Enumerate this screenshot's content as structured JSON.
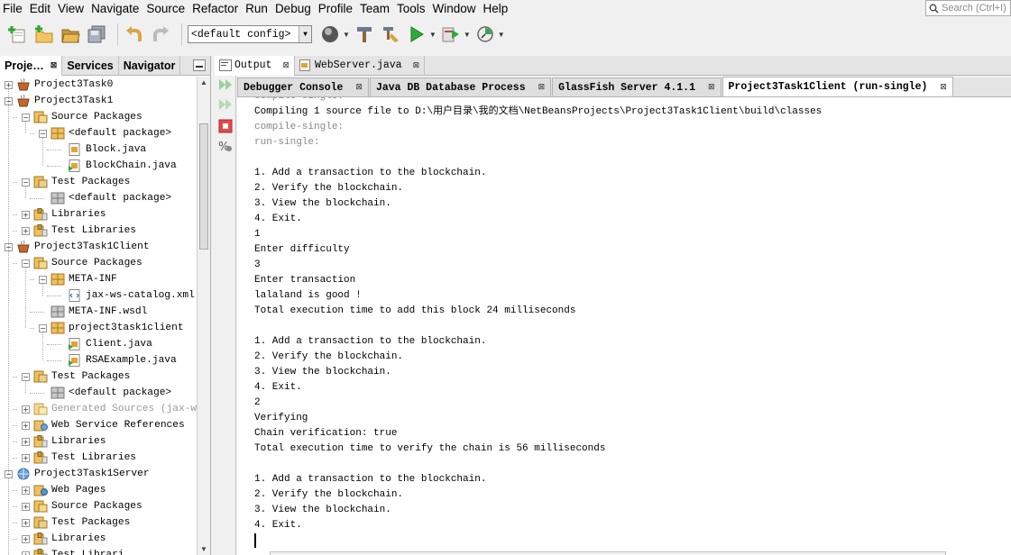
{
  "menu": [
    "File",
    "Edit",
    "View",
    "Navigate",
    "Source",
    "Refactor",
    "Run",
    "Debug",
    "Profile",
    "Team",
    "Tools",
    "Window",
    "Help"
  ],
  "search": {
    "placeholder": "Search (Ctrl+I)"
  },
  "toolbar": {
    "config_value": "<default config>",
    "icons": [
      "new-file-icon",
      "new-project-icon",
      "open-project-icon",
      "save-all-icon",
      "undo-icon",
      "redo-icon",
      "globe-icon",
      "build-icon",
      "clean-build-icon",
      "run-icon",
      "debug-icon",
      "profile-icon"
    ]
  },
  "left_panel": {
    "tabs": [
      {
        "label": "Proje…",
        "active": true
      },
      {
        "label": "Services",
        "active": false
      },
      {
        "label": "Navigator",
        "active": false
      }
    ],
    "tree": [
      {
        "label": "Project3Task0",
        "icon": "java-project-icon",
        "toggle": "+",
        "indent": 0
      },
      {
        "label": "Project3Task1",
        "icon": "java-project-icon",
        "toggle": "-",
        "indent": 0
      },
      {
        "label": "Source Packages",
        "icon": "source-packages-icon",
        "toggle": "-",
        "indent": 1
      },
      {
        "label": "<default package>",
        "icon": "package-icon",
        "toggle": "-",
        "indent": 2
      },
      {
        "label": "Block.java",
        "icon": "java-file-icon",
        "toggle": "",
        "indent": 3
      },
      {
        "label": "BlockChain.java",
        "icon": "java-main-file-icon",
        "toggle": "",
        "indent": 3
      },
      {
        "label": "Test Packages",
        "icon": "test-packages-icon",
        "toggle": "-",
        "indent": 1
      },
      {
        "label": "<default package>",
        "icon": "empty-package-icon",
        "toggle": "",
        "indent": 2
      },
      {
        "label": "Libraries",
        "icon": "libraries-icon",
        "toggle": "+",
        "indent": 1
      },
      {
        "label": "Test Libraries",
        "icon": "libraries-icon",
        "toggle": "+",
        "indent": 1
      },
      {
        "label": "Project3Task1Client",
        "icon": "java-project-icon",
        "toggle": "-",
        "indent": 0
      },
      {
        "label": "Source Packages",
        "icon": "source-packages-icon",
        "toggle": "-",
        "indent": 1
      },
      {
        "label": "META-INF",
        "icon": "package-icon",
        "toggle": "-",
        "indent": 2
      },
      {
        "label": "jax-ws-catalog.xml",
        "icon": "xml-file-icon",
        "toggle": "",
        "indent": 3
      },
      {
        "label": "META-INF.wsdl",
        "icon": "empty-package-icon",
        "toggle": "",
        "indent": 2
      },
      {
        "label": "project3task1client",
        "icon": "package-icon",
        "toggle": "-",
        "indent": 2
      },
      {
        "label": "Client.java",
        "icon": "java-main-file-icon",
        "toggle": "",
        "indent": 3
      },
      {
        "label": "RSAExample.java",
        "icon": "java-main-file-icon",
        "toggle": "",
        "indent": 3
      },
      {
        "label": "Test Packages",
        "icon": "test-packages-icon",
        "toggle": "-",
        "indent": 1
      },
      {
        "label": "<default package>",
        "icon": "empty-package-icon",
        "toggle": "",
        "indent": 2
      },
      {
        "label": "Generated Sources (jax-ws",
        "icon": "generated-sources-icon",
        "toggle": "+",
        "indent": 1,
        "gray": true
      },
      {
        "label": "Web Service References",
        "icon": "web-service-icon",
        "toggle": "+",
        "indent": 1
      },
      {
        "label": "Libraries",
        "icon": "libraries-icon",
        "toggle": "+",
        "indent": 1
      },
      {
        "label": "Test Libraries",
        "icon": "libraries-icon",
        "toggle": "+",
        "indent": 1
      },
      {
        "label": "Project3Task1Server",
        "icon": "web-project-icon",
        "toggle": "-",
        "indent": 0
      },
      {
        "label": "Web Pages",
        "icon": "web-pages-icon",
        "toggle": "+",
        "indent": 1
      },
      {
        "label": "Source Packages",
        "icon": "source-packages-icon",
        "toggle": "+",
        "indent": 1
      },
      {
        "label": "Test Packages",
        "icon": "test-packages-icon",
        "toggle": "+",
        "indent": 1
      },
      {
        "label": "Libraries",
        "icon": "libraries-icon",
        "toggle": "+",
        "indent": 1
      },
      {
        "label": "Test Librari",
        "icon": "libraries-icon",
        "toggle": "+",
        "indent": 1
      }
    ]
  },
  "editor_tabs": [
    {
      "label": "Output",
      "active": true
    },
    {
      "label": "WebServer.java",
      "active": false
    }
  ],
  "output_tabs": [
    {
      "label": "Debugger Console",
      "active": false
    },
    {
      "label": "Java DB Database Process",
      "active": false
    },
    {
      "label": "GlassFish Server 4.1.1",
      "active": false
    },
    {
      "label": "Project3Task1Client (run-single)",
      "active": true
    }
  ],
  "console_lines": [
    {
      "text": "Compiling 1 source file to D:\\用户目录\\我的文档\\NetBeansProjects\\Project3Task1Client\\build\\classes",
      "gray": false
    },
    {
      "text": "compile-single:",
      "gray": true
    },
    {
      "text": "run-single:",
      "gray": true
    },
    {
      "text": "",
      "gray": false
    },
    {
      "text": "1. Add a transaction to the blockchain.",
      "gray": false
    },
    {
      "text": "2. Verify the blockchain.",
      "gray": false
    },
    {
      "text": "3. View the blockchain.",
      "gray": false
    },
    {
      "text": "4. Exit.",
      "gray": false
    },
    {
      "text": "1",
      "gray": false
    },
    {
      "text": "Enter difficulty",
      "gray": false
    },
    {
      "text": "3",
      "gray": false
    },
    {
      "text": "Enter transaction",
      "gray": false
    },
    {
      "text": "lalaland is good !",
      "gray": false
    },
    {
      "text": "Total execution time to add this block 24 milliseconds",
      "gray": false
    },
    {
      "text": "",
      "gray": false
    },
    {
      "text": "1. Add a transaction to the blockchain.",
      "gray": false
    },
    {
      "text": "2. Verify the blockchain.",
      "gray": false
    },
    {
      "text": "3. View the blockchain.",
      "gray": false
    },
    {
      "text": "4. Exit.",
      "gray": false
    },
    {
      "text": "2",
      "gray": false
    },
    {
      "text": "Verifying",
      "gray": false
    },
    {
      "text": "Chain verification: true",
      "gray": false
    },
    {
      "text": "Total execution time to verify the chain is 56 milliseconds",
      "gray": false
    },
    {
      "text": "",
      "gray": false
    },
    {
      "text": "1. Add a transaction to the blockchain.",
      "gray": false
    },
    {
      "text": "2. Verify the blockchain.",
      "gray": false
    },
    {
      "text": "3. View the blockchain.",
      "gray": false
    },
    {
      "text": "4. Exit.",
      "gray": false
    }
  ]
}
